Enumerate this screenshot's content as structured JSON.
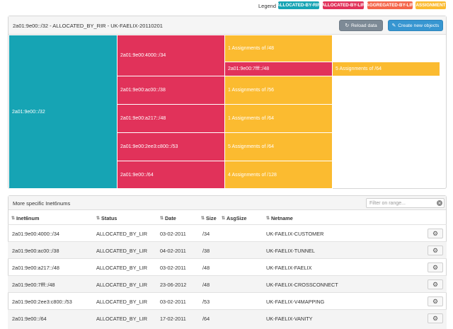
{
  "legend": {
    "label": "Legend",
    "items": [
      {
        "label": "ALLOCATED-BY-RIR",
        "color": "#16a4b4"
      },
      {
        "label": "ALLOCATED-BY-LIR",
        "color": "#e1325a"
      },
      {
        "label": "AGGREGATED-BY-LIR",
        "color": "#f4654a"
      },
      {
        "label": "ASSIGNMENT",
        "color": "#fbbb30"
      }
    ]
  },
  "header": {
    "title": "2a01:9e00::/32 - ALLOCATED_BY_RIR - UK-FAELIX-20110201",
    "reload_label": "Reload data",
    "create_label": "Create new objects",
    "reload_icon": "refresh-icon",
    "create_icon": "edit-icon"
  },
  "treemap": {
    "root": "2a01:9e00::/32",
    "lir": [
      "2a01:9e00:4000::/34",
      "2a01:9e00:ac00::/38",
      "2a01:9e00:a217::/48",
      "2a01:9e00:2ee3:c800::/53",
      "2a01:9e00::/64"
    ],
    "nested_lir": "2a01:9e00:7fff::/48",
    "assignments": [
      "1 Assignments of /48",
      "1 Assignments of /56",
      "1 Assignments of /64",
      "5 Assignments of /64",
      "4 Assignments of /128"
    ],
    "nested_assignment": "5 Assignments of /64"
  },
  "table": {
    "title": "More specific Inet6nums",
    "filter_placeholder": "Filter on range...",
    "clear_icon": "close-icon",
    "columns": [
      "Inet6num",
      "Status",
      "Date",
      "Size",
      "AsgSize",
      "Netname"
    ],
    "rows": [
      {
        "inet6num": "2a01:9e00:4000::/34",
        "status": "ALLOCATED_BY_LIR",
        "date": "03-02-2011",
        "size": "/34",
        "asgsize": "",
        "netname": "UK-FAELIX-CUSTOMER"
      },
      {
        "inet6num": "2a01:9e00:ac00::/38",
        "status": "ALLOCATED_BY_LIR",
        "date": "04-02-2011",
        "size": "/38",
        "asgsize": "",
        "netname": "UK-FAELIX-TUNNEL"
      },
      {
        "inet6num": "2a01:9e00:a217::/48",
        "status": "ALLOCATED_BY_LIR",
        "date": "03-02-2011",
        "size": "/48",
        "asgsize": "",
        "netname": "UK-FAELIX-FAELIX"
      },
      {
        "inet6num": "2a01:9e00:7fff::/48",
        "status": "ALLOCATED_BY_LIR",
        "date": "23-06-2012",
        "size": "/48",
        "asgsize": "",
        "netname": "UK-FAELIX-CROSSCONNECT"
      },
      {
        "inet6num": "2a01:9e00:2ee3:c800::/53",
        "status": "ALLOCATED_BY_LIR",
        "date": "03-02-2011",
        "size": "/53",
        "asgsize": "",
        "netname": "UK-FAELIX-V4MAPPING"
      },
      {
        "inet6num": "2a01:9e00::/64",
        "status": "ALLOCATED_BY_LIR",
        "date": "17-02-2011",
        "size": "/64",
        "asgsize": "",
        "netname": "UK-FAELIX-VANITY"
      }
    ]
  }
}
